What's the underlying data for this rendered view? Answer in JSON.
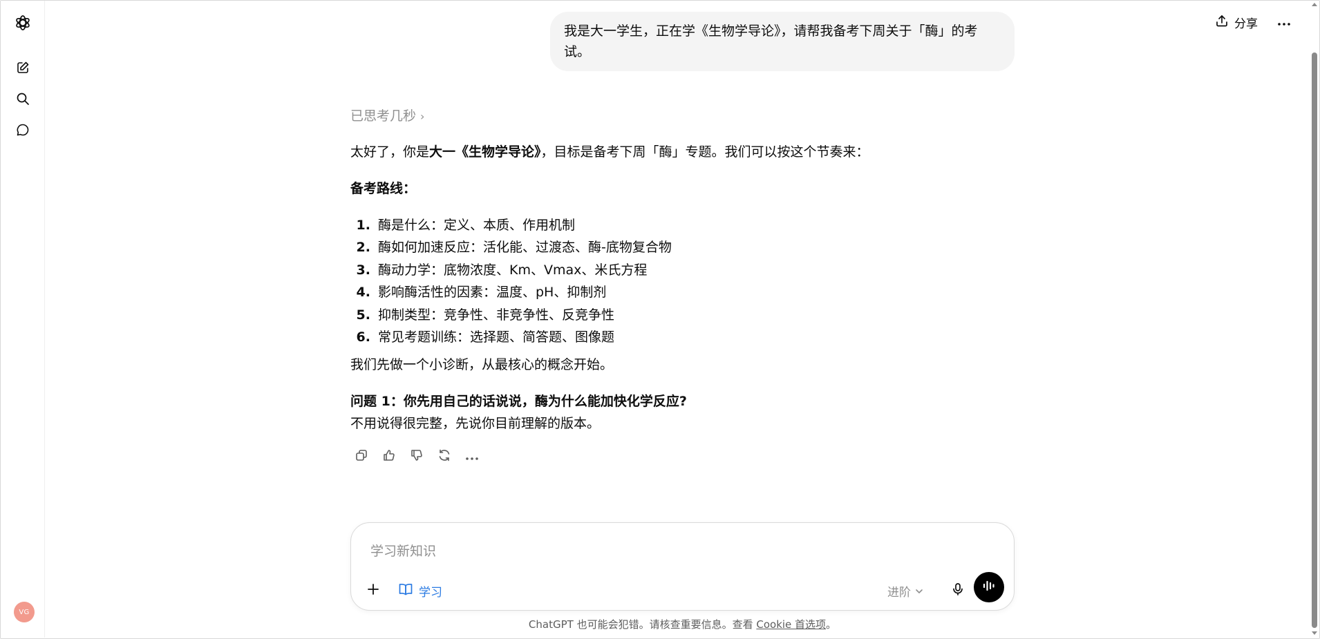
{
  "sidebar": {
    "logo_icon": "openai-logo-icon",
    "items": [
      {
        "name": "new-chat",
        "icon": "edit-icon"
      },
      {
        "name": "search",
        "icon": "search-icon"
      },
      {
        "name": "chats",
        "icon": "chat-bubble-icon"
      }
    ],
    "avatar_initials": "VG",
    "avatar_color": "#f29a8d"
  },
  "header": {
    "share_label": "分享",
    "share_icon": "upload-icon",
    "more_icon": "ellipsis-icon"
  },
  "conversation": {
    "user_message": "我是大一学生，正在学《生物学导论》，请帮我备考下周关于「酶」的考试。",
    "thought_label": "已思考几秒",
    "intro": {
      "before": "太好了，你是",
      "bold": "大一《生物学导论》",
      "after": "，目标是备考下周「酶」专题。我们可以按这个节奏来："
    },
    "route_title": "备考路线：",
    "steps": [
      {
        "num": "1.",
        "text": "酶是什么：定义、本质、作用机制"
      },
      {
        "num": "2.",
        "text": "酶如何加速反应：活化能、过渡态、酶-底物复合物"
      },
      {
        "num": "3.",
        "text": "酶动力学：底物浓度、Km、Vmax、米氏方程"
      },
      {
        "num": "4.",
        "text": "影响酶活性的因素：温度、pH、抑制剂"
      },
      {
        "num": "5.",
        "text": "抑制类型：竞争性、非竞争性、反竞争性"
      },
      {
        "num": "6.",
        "text": "常见考题训练：选择题、简答题、图像题"
      }
    ],
    "diagnosis": "我们先做一个小诊断，从最核心的概念开始。",
    "question_title": "问题 1：你先用自己的话说说，酶为什么能加快化学反应?",
    "question_sub": "不用说得很完整，先说你目前理解的版本。",
    "actions": [
      "copy-icon",
      "thumbs-up-icon",
      "thumbs-down-icon",
      "regenerate-icon",
      "more-icon"
    ]
  },
  "composer": {
    "placeholder": "学习新知识",
    "mode_label": "学习",
    "level_label": "进阶",
    "accent_color": "#2a7ae2"
  },
  "footer": {
    "disclaimer_prefix": "ChatGPT 也可能会犯错。请核查重要信息。查看 ",
    "cookie_link": "Cookie 首选项",
    "disclaimer_suffix": "。"
  }
}
